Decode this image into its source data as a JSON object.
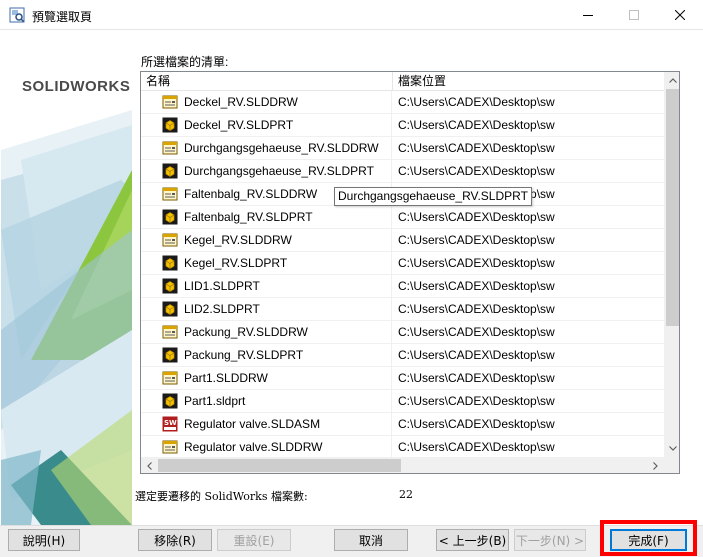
{
  "window": {
    "title": "預覽選取頁"
  },
  "side_panel": {
    "brand": "SOLIDWORKS",
    "colors": {
      "green": "#8cc63f",
      "light_blue": "#a9cce3",
      "teal": "#3a8c8c"
    }
  },
  "list": {
    "caption": "所選檔案的清單:",
    "columns": [
      "名稱",
      "檔案位置"
    ],
    "rows": [
      {
        "name": "Deckel_RV.SLDDRW",
        "location": "C:\\Users\\CADEX\\Desktop\\sw",
        "icon": "drawing-icon"
      },
      {
        "name": "Deckel_RV.SLDPRT",
        "location": "C:\\Users\\CADEX\\Desktop\\sw",
        "icon": "part-icon"
      },
      {
        "name": "Durchgangsgehaeuse_RV.SLDDRW",
        "location": "C:\\Users\\CADEX\\Desktop\\sw",
        "icon": "drawing-icon"
      },
      {
        "name": "Durchgangsgehaeuse_RV.SLDPRT",
        "location": "C:\\Users\\CADEX\\Desktop\\sw",
        "icon": "part-icon"
      },
      {
        "name": "Faltenbalg_RV.SLDDRW",
        "location": "C:\\Users\\CADEX\\Desktop\\sw",
        "icon": "drawing-icon"
      },
      {
        "name": "Faltenbalg_RV.SLDPRT",
        "location": "C:\\Users\\CADEX\\Desktop\\sw",
        "icon": "part-icon"
      },
      {
        "name": "Kegel_RV.SLDDRW",
        "location": "C:\\Users\\CADEX\\Desktop\\sw",
        "icon": "drawing-icon"
      },
      {
        "name": "Kegel_RV.SLDPRT",
        "location": "C:\\Users\\CADEX\\Desktop\\sw",
        "icon": "part-icon"
      },
      {
        "name": "LID1.SLDPRT",
        "location": "C:\\Users\\CADEX\\Desktop\\sw",
        "icon": "part-icon"
      },
      {
        "name": "LID2.SLDPRT",
        "location": "C:\\Users\\CADEX\\Desktop\\sw",
        "icon": "part-icon"
      },
      {
        "name": "Packung_RV.SLDDRW",
        "location": "C:\\Users\\CADEX\\Desktop\\sw",
        "icon": "drawing-icon"
      },
      {
        "name": "Packung_RV.SLDPRT",
        "location": "C:\\Users\\CADEX\\Desktop\\sw",
        "icon": "part-icon"
      },
      {
        "name": "Part1.SLDDRW",
        "location": "C:\\Users\\CADEX\\Desktop\\sw",
        "icon": "drawing-icon"
      },
      {
        "name": "Part1.sldprt",
        "location": "C:\\Users\\CADEX\\Desktop\\sw",
        "icon": "part-icon"
      },
      {
        "name": "Regulator valve.SLDASM",
        "location": "C:\\Users\\CADEX\\Desktop\\sw",
        "icon": "assembly-icon"
      },
      {
        "name": "Regulator valve.SLDDRW",
        "location": "C:\\Users\\CADEX\\Desktop\\sw",
        "icon": "drawing-icon"
      }
    ],
    "tooltip": "Durchgangsgehaeuse_RV.SLDPRT"
  },
  "summary": {
    "label": "選定要遷移的 SolidWorks 檔案數:",
    "count": "22"
  },
  "buttons": {
    "help": "說明(H)",
    "remove": "移除(R)",
    "reset": "重設(E)",
    "cancel": "取消",
    "back": "< 上一步(B)",
    "next": "下一步(N) >",
    "finish": "完成(F)"
  }
}
